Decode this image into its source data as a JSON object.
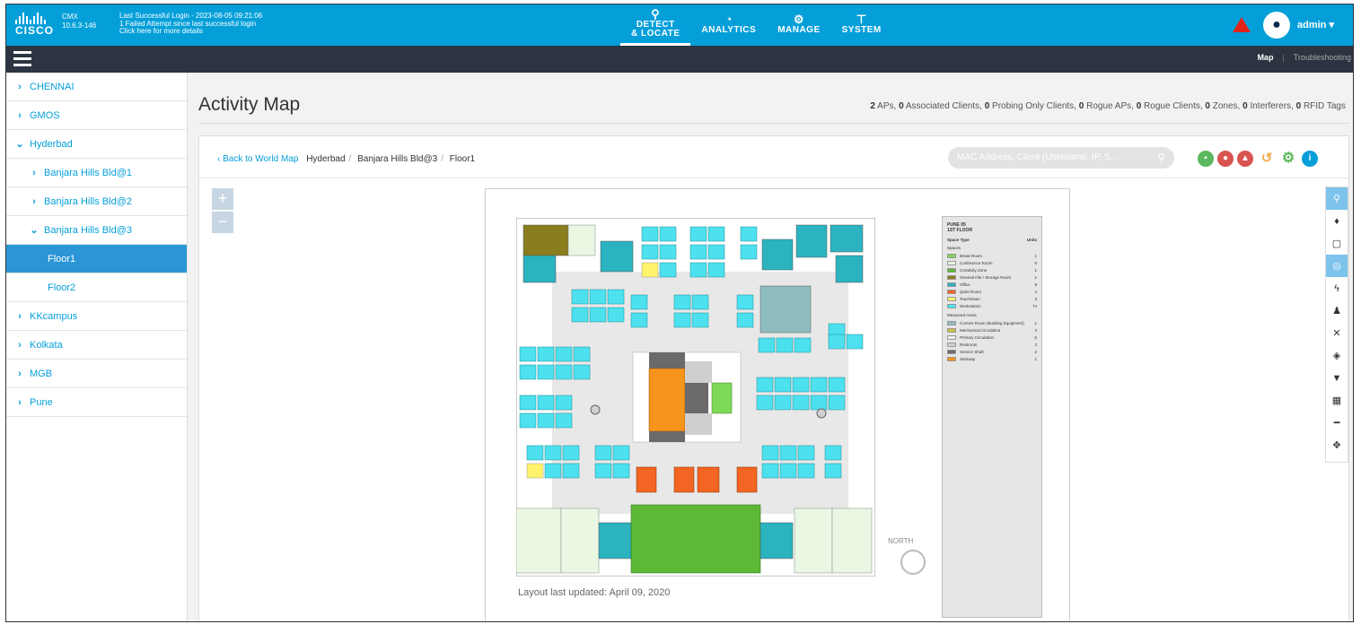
{
  "header": {
    "logo_text": "CISCO",
    "product": [
      "CMX",
      "10.6.3-146"
    ],
    "login_info": [
      "Last Successful Login - 2023-08-05 09:21:06",
      "1 Failed Attempt since last successful login",
      "Click here for more details"
    ],
    "nav": [
      {
        "label1": "DETECT",
        "label2": "& LOCATE",
        "icon": "location-pin-icon"
      },
      {
        "label1": "ANALYTICS",
        "label2": "",
        "icon": "dashboard-icon"
      },
      {
        "label1": "MANAGE",
        "label2": "",
        "icon": "cogs-icon"
      },
      {
        "label1": "SYSTEM",
        "label2": "",
        "icon": "hierarchy-icon"
      }
    ],
    "user": "admin ▾",
    "alert_color": "#e2231a",
    "accent_color": "#049fd9"
  },
  "subbar": {
    "tabs": [
      "Map",
      "Troubleshooting"
    ]
  },
  "sidebar": {
    "items": [
      {
        "label": "CHENNAI"
      },
      {
        "label": "GMOS"
      },
      {
        "label": "Hyderbad"
      },
      {
        "label": "Banjara Hills Bld@1"
      },
      {
        "label": "Banjara Hills Bld@2"
      },
      {
        "label": "Banjara Hills Bld@3"
      },
      {
        "label": "Floor1"
      },
      {
        "label": "Floor2"
      },
      {
        "label": "KKcampus"
      },
      {
        "label": "Kolkata"
      },
      {
        "label": "MGB"
      },
      {
        "label": "Pune"
      }
    ]
  },
  "page": {
    "title": "Activity Map",
    "summary": [
      {
        "count": "2",
        "label": "APs,"
      },
      {
        "count": "0",
        "label": "Associated Clients,"
      },
      {
        "count": "0",
        "label": "Probing Only Clients,"
      },
      {
        "count": "0",
        "label": "Rogue APs,"
      },
      {
        "count": "0",
        "label": "Rogue Clients,"
      },
      {
        "count": "0",
        "label": "Zones,"
      },
      {
        "count": "0",
        "label": "Interferers,"
      },
      {
        "count": "0",
        "label": "RFID Tags"
      }
    ]
  },
  "breadcrumb": {
    "back": "‹ Back to World Map",
    "items": [
      "Hyderbad",
      "Banjara Hills Bld@3",
      "Floor1"
    ]
  },
  "search": {
    "placeholder": "MAC Address, Client (Username, IP, S..."
  },
  "map": {
    "layout_note": "Layout last updated: April 09, 2020",
    "north": "NORTH",
    "legend": {
      "title1": "PUNE 05",
      "title2": "1ST FLOOR",
      "head_type": "Space Type",
      "head_units": "Units",
      "section1": "Spaces",
      "spaces": [
        {
          "name": "Break Room",
          "count": "1",
          "color": "#7ed957"
        },
        {
          "name": "Conference Room",
          "count": "5",
          "color": "#e9f7e3"
        },
        {
          "name": "Creativity Zone",
          "count": "1",
          "color": "#5cb835"
        },
        {
          "name": "General File / Storage Room",
          "count": "1",
          "color": "#8a7d1d"
        },
        {
          "name": "Office",
          "count": "8",
          "color": "#2bb3c0"
        },
        {
          "name": "Quiet Room",
          "count": "4",
          "color": "#f26522"
        },
        {
          "name": "Touchdown",
          "count": "2",
          "color": "#fff36b"
        },
        {
          "name": "Workstation",
          "count": "74",
          "color": "#4de1ef"
        }
      ],
      "section2": "Measured Areas",
      "areas": [
        {
          "name": "Comms Room (Building Equipment)",
          "count": "1",
          "color": "#8fbcbf"
        },
        {
          "name": "Mechanical Circulation",
          "count": "2",
          "color": "#c7c43a"
        },
        {
          "name": "Primary Circulation",
          "count": "5",
          "color": "#f0f0f0"
        },
        {
          "name": "Restroom",
          "count": "2",
          "color": "#cfcfcf"
        },
        {
          "name": "Service Shaft",
          "count": "2",
          "color": "#6a6a6a"
        },
        {
          "name": "Stairway",
          "count": "1",
          "color": "#f7941d"
        }
      ]
    }
  }
}
